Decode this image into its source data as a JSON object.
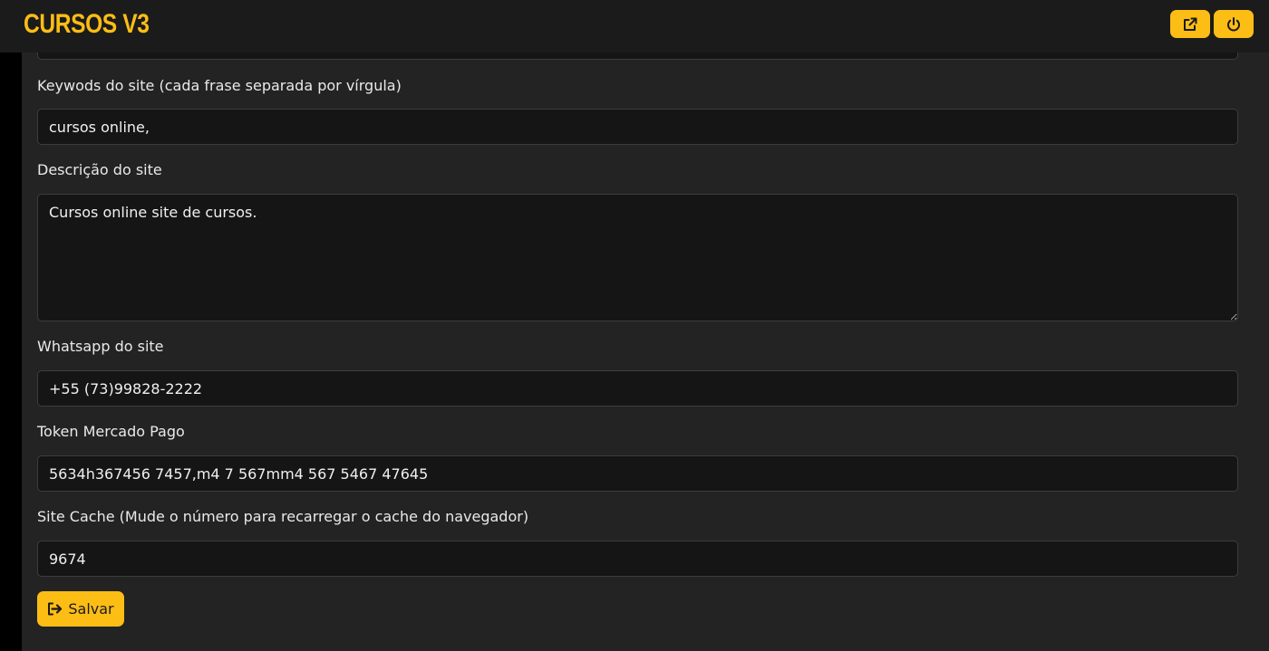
{
  "header": {
    "logo": "CURSOS V3",
    "open_site_icon": "external-link-icon",
    "logout_icon": "power-icon",
    "accent_color": "#fcbd15"
  },
  "form": {
    "keywords": {
      "label": "Keywods do site (cada frase separada por vírgula)",
      "value": "cursos online,"
    },
    "description": {
      "label": "Descrição do site",
      "value": "Cursos online site de cursos."
    },
    "whatsapp": {
      "label": "Whatsapp do site",
      "value": "+55 (73)99828-2222"
    },
    "token": {
      "label": "Token Mercado Pago",
      "value": "5634h367456 7457,m4 7 567mm4 567 5467 47645"
    },
    "cache": {
      "label": "Site Cache (Mude o número para recarregar o cache do navegador)",
      "value": "9674"
    },
    "save": {
      "label": "Salvar",
      "icon": "sign-out-icon"
    }
  }
}
